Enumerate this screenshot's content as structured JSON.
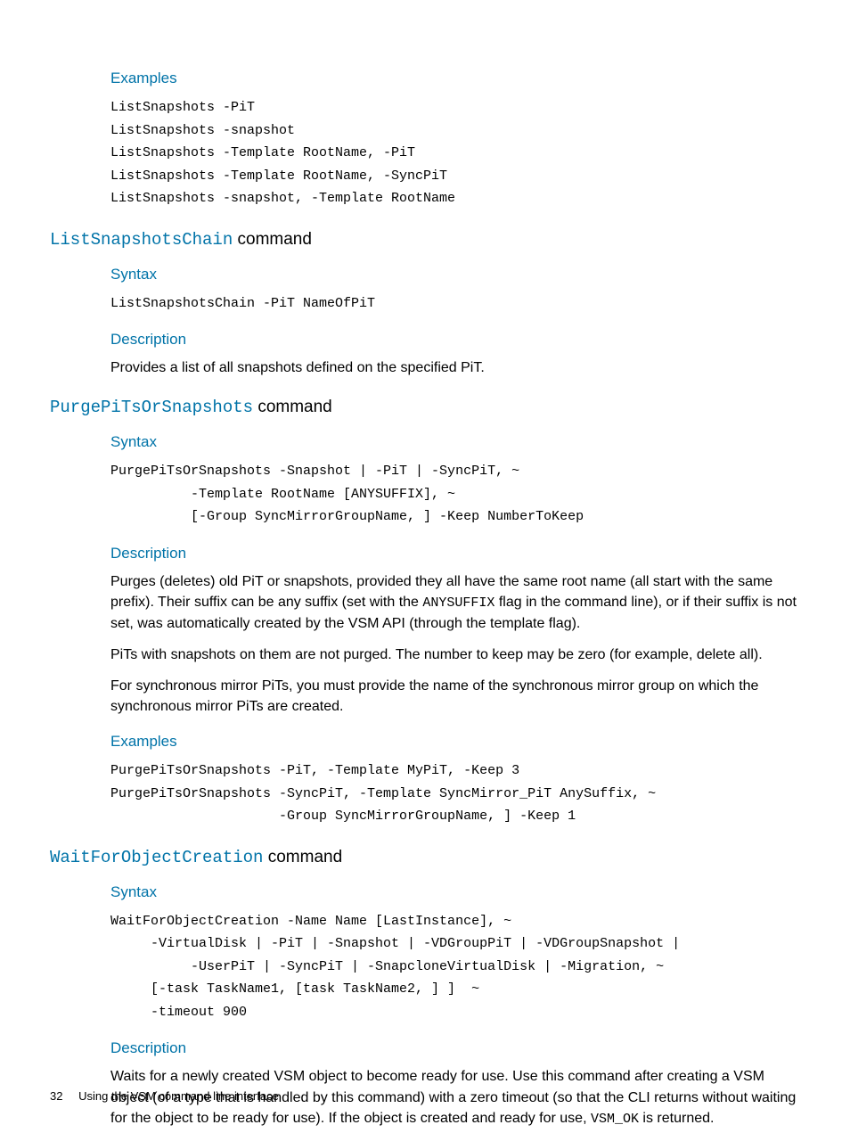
{
  "sec0": {
    "examples_heading": "Examples",
    "examples_code": "ListSnapshots -PiT\nListSnapshots -snapshot\nListSnapshots -Template RootName, -PiT\nListSnapshots -Template RootName, -SyncPiT\nListSnapshots -snapshot, -Template RootName"
  },
  "sec1": {
    "title_mono": "ListSnapshotsChain",
    "title_word": " command",
    "syntax_heading": "Syntax",
    "syntax_code": "ListSnapshotsChain -PiT NameOfPiT",
    "description_heading": "Description",
    "description_body": "Provides a list of all snapshots defined on the specified PiT."
  },
  "sec2": {
    "title_mono": "PurgePiTsOrSnapshots",
    "title_word": " command",
    "syntax_heading": "Syntax",
    "syntax_code": "PurgePiTsOrSnapshots -Snapshot | -PiT | -SyncPiT, ~\n          -Template RootName [ANYSUFFIX], ~\n          [-Group SyncMirrorGroupName, ] -Keep NumberToKeep",
    "description_heading": "Description",
    "desc_p1_a": "Purges (deletes) old PiT or snapshots, provided they all have the same root name (all start with the same prefix). Their suffix can be any suffix (set with the ",
    "desc_p1_code": "ANYSUFFIX",
    "desc_p1_b": " flag in the command line), or if their suffix is not set, was automatically created by the VSM API (through the template flag).",
    "desc_p2": "PiTs with snapshots on them are not purged. The number to keep may be zero (for example, delete all).",
    "desc_p3": "For synchronous mirror PiTs, you must provide the name of the synchronous mirror group on which the synchronous mirror PiTs are created.",
    "examples_heading": "Examples",
    "examples_code": "PurgePiTsOrSnapshots -PiT, -Template MyPiT, -Keep 3\nPurgePiTsOrSnapshots -SyncPiT, -Template SyncMirror_PiT AnySuffix, ~\n                     -Group SyncMirrorGroupName, ] -Keep 1"
  },
  "sec3": {
    "title_mono": "WaitForObjectCreation",
    "title_word": " command",
    "syntax_heading": "Syntax",
    "syntax_code": "WaitForObjectCreation -Name Name [LastInstance], ~\n     -VirtualDisk | -PiT | -Snapshot | -VDGroupPiT | -VDGroupSnapshot |\n          -UserPiT | -SyncPiT | -SnapcloneVirtualDisk | -Migration, ~\n     [-task TaskName1, [task TaskName2, ] ]  ~\n     -timeout 900",
    "description_heading": "Description",
    "desc_p1_a": "Waits for a newly created VSM object to become ready for use. Use this command after creating a VSM object (of a type that is handled by this command) with a zero timeout (so that the CLI returns without waiting for the object to be ready for use). If the object is created and ready for use, ",
    "desc_p1_code": "VSM_OK",
    "desc_p1_b": " is returned."
  },
  "footer": {
    "page_number": "32",
    "chapter": "Using the VSM command line interface"
  }
}
